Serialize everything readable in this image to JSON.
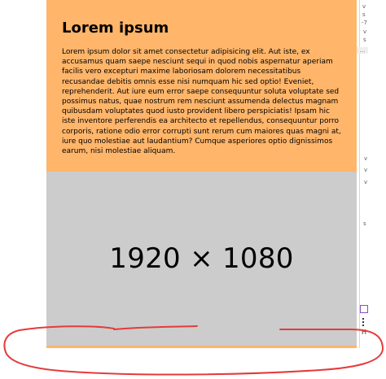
{
  "card": {
    "title": "Lorem ipsum",
    "body": "Lorem ipsum dolor sit amet consectetur adipisicing elit. Aut iste, ex accusamus quam saepe nesciunt sequi in quod nobis aspernatur aperiam facilis vero excepturi maxime laboriosam dolorem necessitatibus recusandae debitis omnis esse nisi numquam hic sed optio! Eveniet, reprehenderit. Aut iure eum error saepe consequuntur soluta voluptate sed possimus natus, quae nostrum rem nesciunt assumenda delectus magnam quibusdam voluptates quod iusto provident libero perspiciatis! Ipsam hic iste inventore perferendis ea architecto et repellendus, consequuntur porro corporis, ratione odio error corrupti sunt rerum cum maiores quas magni at, iure quo molestiae aut laudantium? Cumque asperiores optio dignissimos earum, nisi molestiae aliquam."
  },
  "media": {
    "dimensions": "1920 × 1080"
  },
  "right_rail": {
    "top_text_1": "v",
    "top_text_2": "s",
    "top_text_3": "-7",
    "ellipsis": "...",
    "bottom_letter": "H"
  },
  "annotation": {
    "color": "#e53b3b"
  }
}
